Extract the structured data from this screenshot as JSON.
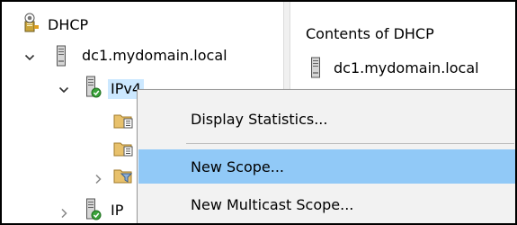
{
  "tree": {
    "root_label": "DHCP",
    "server_label": "dc1.mydomain.local",
    "ipv4_label": "IPv4",
    "ipv6_label_partial": "IP"
  },
  "details": {
    "heading": "Contents of DHCP",
    "item_label": "dc1.mydomain.local"
  },
  "context_menu": {
    "items": [
      {
        "label": "Display Statistics..."
      },
      {
        "label": "New Scope..."
      },
      {
        "label": "New Multicast Scope..."
      }
    ],
    "highlighted_item": "New Scope..."
  },
  "icons": {
    "root": "dhcp-server-icon",
    "server": "server-tower-icon",
    "ipv4": "ipv4-node-icon",
    "child1": "folder-list-icon",
    "child2": "folder-list-icon",
    "child3": "filter-folder-icon"
  },
  "colors": {
    "selection": "#cce8ff",
    "menu_highlight": "#91c9f7",
    "menu_background": "#f2f2f2"
  }
}
